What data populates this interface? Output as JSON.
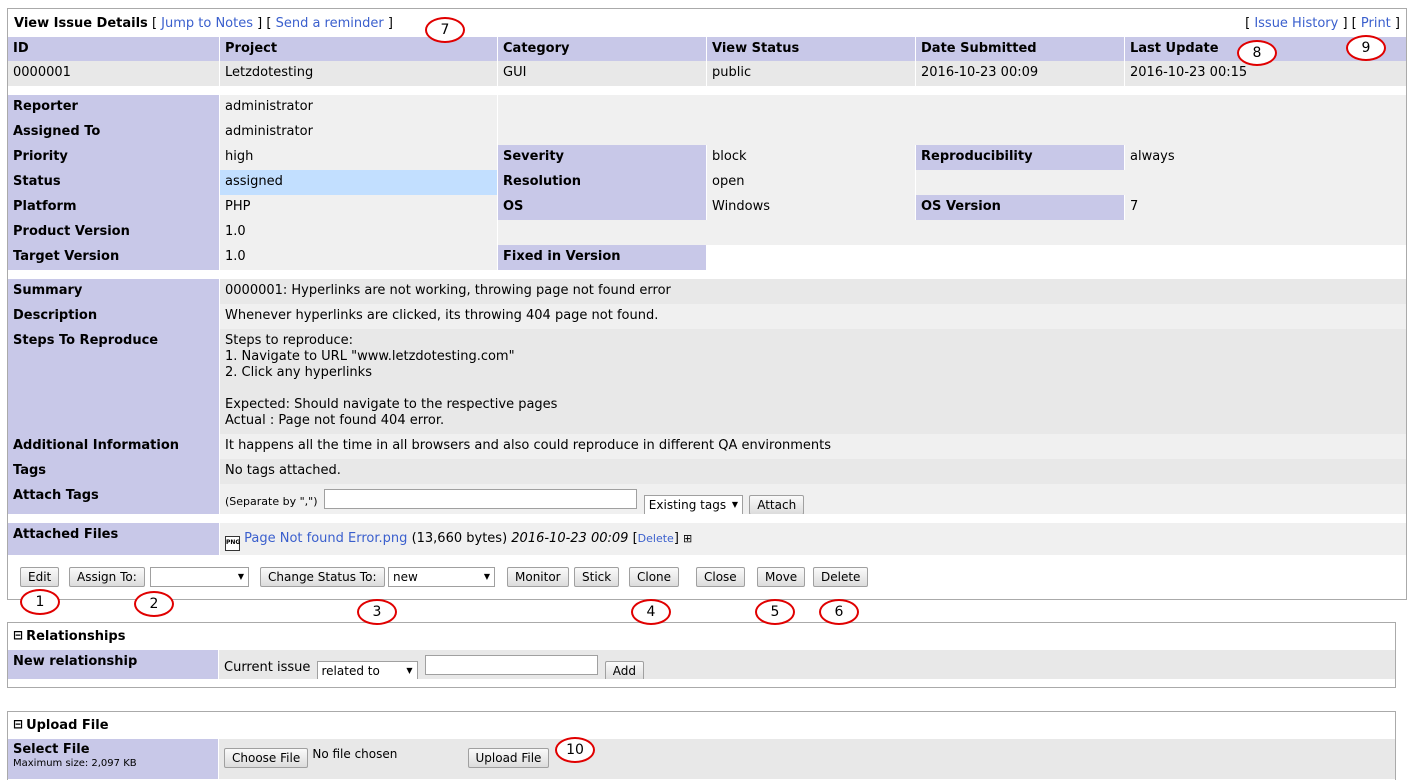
{
  "header": {
    "title": "View Issue Details",
    "jump_to_notes": "Jump to Notes",
    "send_reminder": "Send a reminder",
    "issue_history": "Issue History",
    "print": "Print"
  },
  "columns": [
    "ID",
    "Project",
    "Category",
    "View Status",
    "Date Submitted",
    "Last Update"
  ],
  "values": [
    "0000001",
    "Letzdotesting",
    "GUI",
    "public",
    "2016-10-23 00:09",
    "2016-10-23 00:15"
  ],
  "fields": {
    "reporter_label": "Reporter",
    "reporter": "administrator",
    "assigned_label": "Assigned To",
    "assigned": "administrator",
    "priority_label": "Priority",
    "priority": "high",
    "severity_label": "Severity",
    "severity": "block",
    "repro_label": "Reproducibility",
    "repro": "always",
    "status_label": "Status",
    "status": "assigned",
    "resolution_label": "Resolution",
    "resolution": "open",
    "platform_label": "Platform",
    "platform": "PHP",
    "os_label": "OS",
    "os": "Windows",
    "osver_label": "OS Version",
    "osver": "7",
    "product_label": "Product Version",
    "product": "1.0",
    "target_label": "Target Version",
    "target": "1.0",
    "fixed_label": "Fixed in Version",
    "fixed": ""
  },
  "details": {
    "summary_label": "Summary",
    "summary": "0000001: Hyperlinks are not working, throwing page not found error",
    "description_label": "Description",
    "description": "Whenever hyperlinks are clicked, its throwing 404 page not found.",
    "steps_label": "Steps To Reproduce",
    "steps": "Steps to reproduce:\n1. Navigate to URL \"www.letzdotesting.com\"\n2. Click any hyperlinks\n\nExpected: Should navigate to the respective pages\nActual : Page not found 404 error.",
    "additional_label": "Additional Information",
    "additional": "It happens all the time in all browsers and also could reproduce in different QA environments",
    "tags_label": "Tags",
    "tags": "No tags attached.",
    "attach_tags_label": "Attach Tags",
    "separate_hint": "(Separate by \",\")",
    "existing_tags": "Existing tags",
    "attach_button": "Attach"
  },
  "files": {
    "label": "Attached Files",
    "icon": "png-file-icon",
    "name": "Page Not found Error.png",
    "size": "(13,660 bytes)",
    "date": "2016-10-23 00:09",
    "delete": "Delete",
    "open_bracket": "[",
    "close_bracket": "]",
    "expand": "⊞"
  },
  "actions": {
    "edit": "Edit",
    "assign_to": "Assign To:",
    "assign_value": "",
    "change_status": "Change Status To:",
    "status_value": "new",
    "monitor": "Monitor",
    "stick": "Stick",
    "clone": "Clone",
    "close": "Close",
    "move": "Move",
    "delete": "Delete"
  },
  "relationships": {
    "title": "Relationships",
    "collapse": "⊟",
    "new_label": "New relationship",
    "current_issue": "Current issue",
    "type_value": "related to",
    "add": "Add"
  },
  "upload": {
    "title": "Upload File",
    "collapse": "⊟",
    "select_label": "Select File",
    "max_size": "Maximum size: 2,097 KB",
    "choose": "Choose File",
    "no_file": "No file chosen",
    "upload_button": "Upload File"
  },
  "annotations": [
    "1",
    "2",
    "3",
    "4",
    "5",
    "6",
    "7",
    "8",
    "9",
    "10"
  ],
  "brackets": {
    "open": "[",
    "close": "]",
    "sep": "] ["
  },
  "colors": {
    "label_bg": "#c8c8e8",
    "status_assigned": "#c2dfff",
    "link": "#3a5fcd",
    "annotation": "#e00000"
  }
}
